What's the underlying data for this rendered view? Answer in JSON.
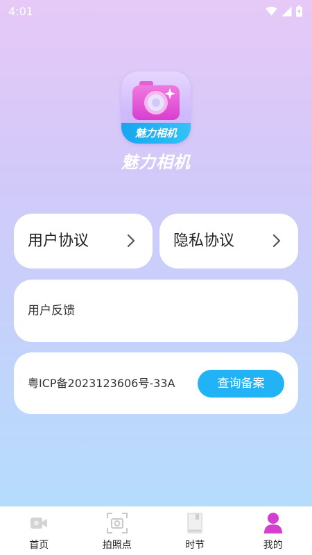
{
  "status_bar": {
    "time": "4:01"
  },
  "app": {
    "logo_text": "魅力相机",
    "name": "魅力相机"
  },
  "cards": {
    "user_agreement": "用户协议",
    "privacy_agreement": "隐私协议",
    "feedback": "用户反馈",
    "icp_number": "粤ICP备2023123606号-33A",
    "icp_query_button": "查询备案"
  },
  "tabbar": {
    "active_index": 3,
    "items": [
      {
        "label": "首页",
        "icon": "video-camera-icon"
      },
      {
        "label": "拍照点",
        "icon": "scan-camera-icon"
      },
      {
        "label": "时节",
        "icon": "book-icon"
      },
      {
        "label": "我的",
        "icon": "person-icon"
      }
    ]
  },
  "colors": {
    "accent": "#22b3f6",
    "active_tab": "#d43fd0",
    "inactive_tab": "#cfcfcf"
  }
}
